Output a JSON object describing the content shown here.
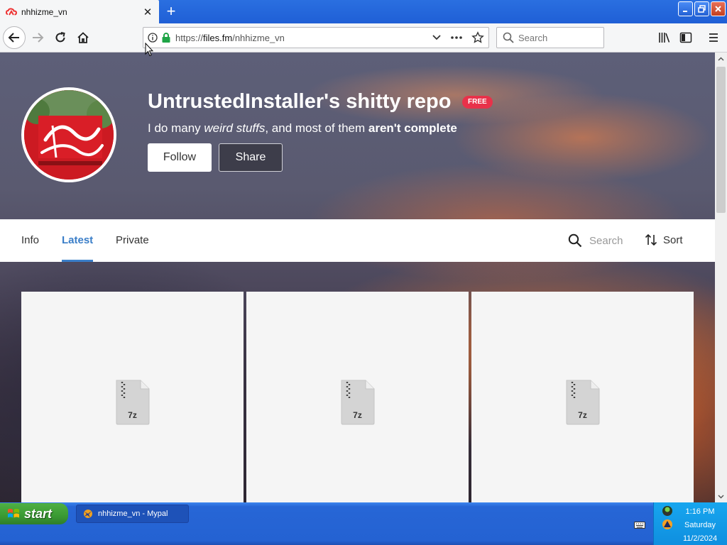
{
  "browser": {
    "tab_title": "nhhizme_vn",
    "url_scheme": "https://",
    "url_host": "files.fm",
    "url_path": "/nhhizme_vn",
    "search_placeholder": "Search"
  },
  "profile": {
    "title": "UntrustedInstaller's shitty repo",
    "badge": "FREE",
    "desc_1": "I do many ",
    "desc_2": "weird stuffs",
    "desc_3": ", and most of them ",
    "desc_4": "aren't complete",
    "follow_label": "Follow",
    "share_label": "Share"
  },
  "tabs": {
    "info": "Info",
    "latest": "Latest",
    "private": "Private",
    "search": "Search",
    "sort": "Sort"
  },
  "files": [
    {
      "ext": "7z"
    },
    {
      "ext": "7z"
    },
    {
      "ext": "7z"
    }
  ],
  "taskbar": {
    "start_label": "start",
    "task_title": "nhhizme_vn - Mypal",
    "time": "1:16 PM",
    "day": "Saturday",
    "date": "11/2/2024"
  },
  "colors": {
    "accent_blue": "#3a7ec8",
    "badge_red": "#e8324a",
    "xp_blue": "#2462d2",
    "xp_green": "#3a9a33"
  }
}
